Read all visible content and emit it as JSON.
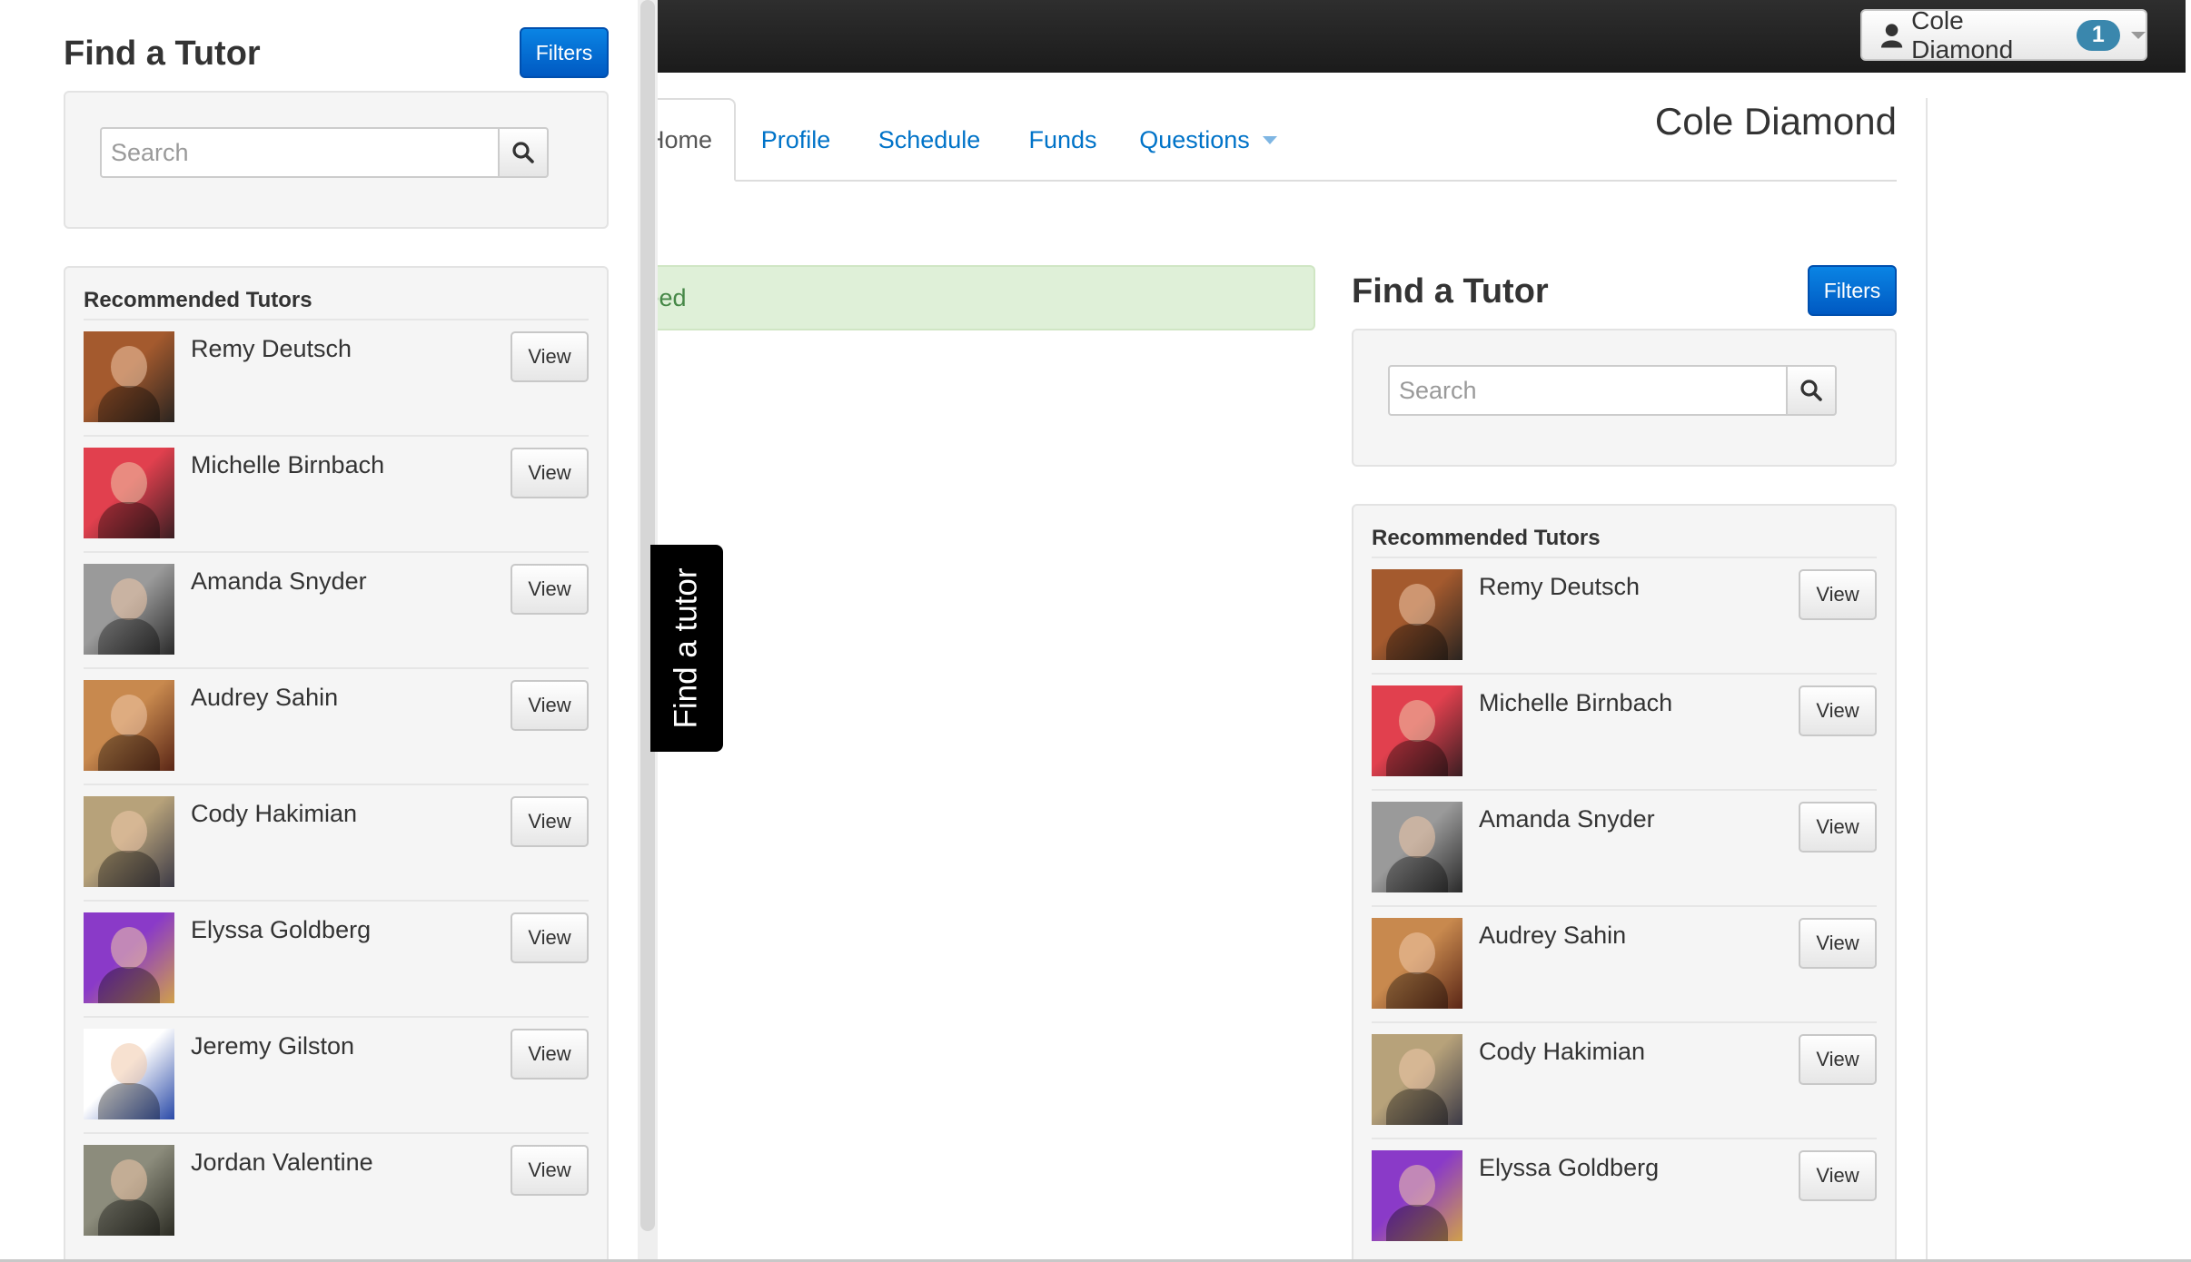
{
  "user_menu": {
    "name": "Cole Diamond",
    "badge": "1"
  },
  "tabs": [
    {
      "label": "Home",
      "visible_text": "Home"
    },
    {
      "label": "Profile"
    },
    {
      "label": "Schedule"
    },
    {
      "label": "Funds"
    },
    {
      "label": "Questions"
    }
  ],
  "header": {
    "name": "Cole Diamond"
  },
  "feed": {
    "label": "Feed"
  },
  "drawer_tab": {
    "label": "Find a tutor"
  },
  "find_tutor": {
    "title": "Find a Tutor",
    "filters_label": "Filters",
    "search_placeholder": "Search",
    "recommended_heading": "Recommended Tutors",
    "view_label": "View"
  },
  "tutors": [
    {
      "name": "Remy Deutsch",
      "photo_colors": [
        "#a45a2e",
        "#2a2420"
      ]
    },
    {
      "name": "Michelle Birnbach",
      "photo_colors": [
        "#e1404e",
        "#3a1e22"
      ]
    },
    {
      "name": "Amanda Snyder",
      "photo_colors": [
        "#9a9a9a",
        "#2a2a2a"
      ]
    },
    {
      "name": "Audrey Sahin",
      "photo_colors": [
        "#c8894e",
        "#5a2616"
      ]
    },
    {
      "name": "Cody Hakimian",
      "photo_colors": [
        "#b7a27a",
        "#3c3a46"
      ]
    },
    {
      "name": "Elyssa Goldberg",
      "photo_colors": [
        "#8a3ac8",
        "#d0a04a"
      ]
    },
    {
      "name": "Jeremy Gilston",
      "photo_colors": [
        "#ffffff",
        "#2a4aa8"
      ]
    },
    {
      "name": "Jordan Valentine",
      "photo_colors": [
        "#8c8c7c",
        "#2c2c24"
      ]
    }
  ],
  "colors": {
    "link": "#0073c8",
    "primary_button": "#0a84e4",
    "alert_success_bg": "#dff0d8",
    "alert_success_text": "#468847",
    "badge": "#3a87ad",
    "topbar": "#1b1b1b"
  }
}
